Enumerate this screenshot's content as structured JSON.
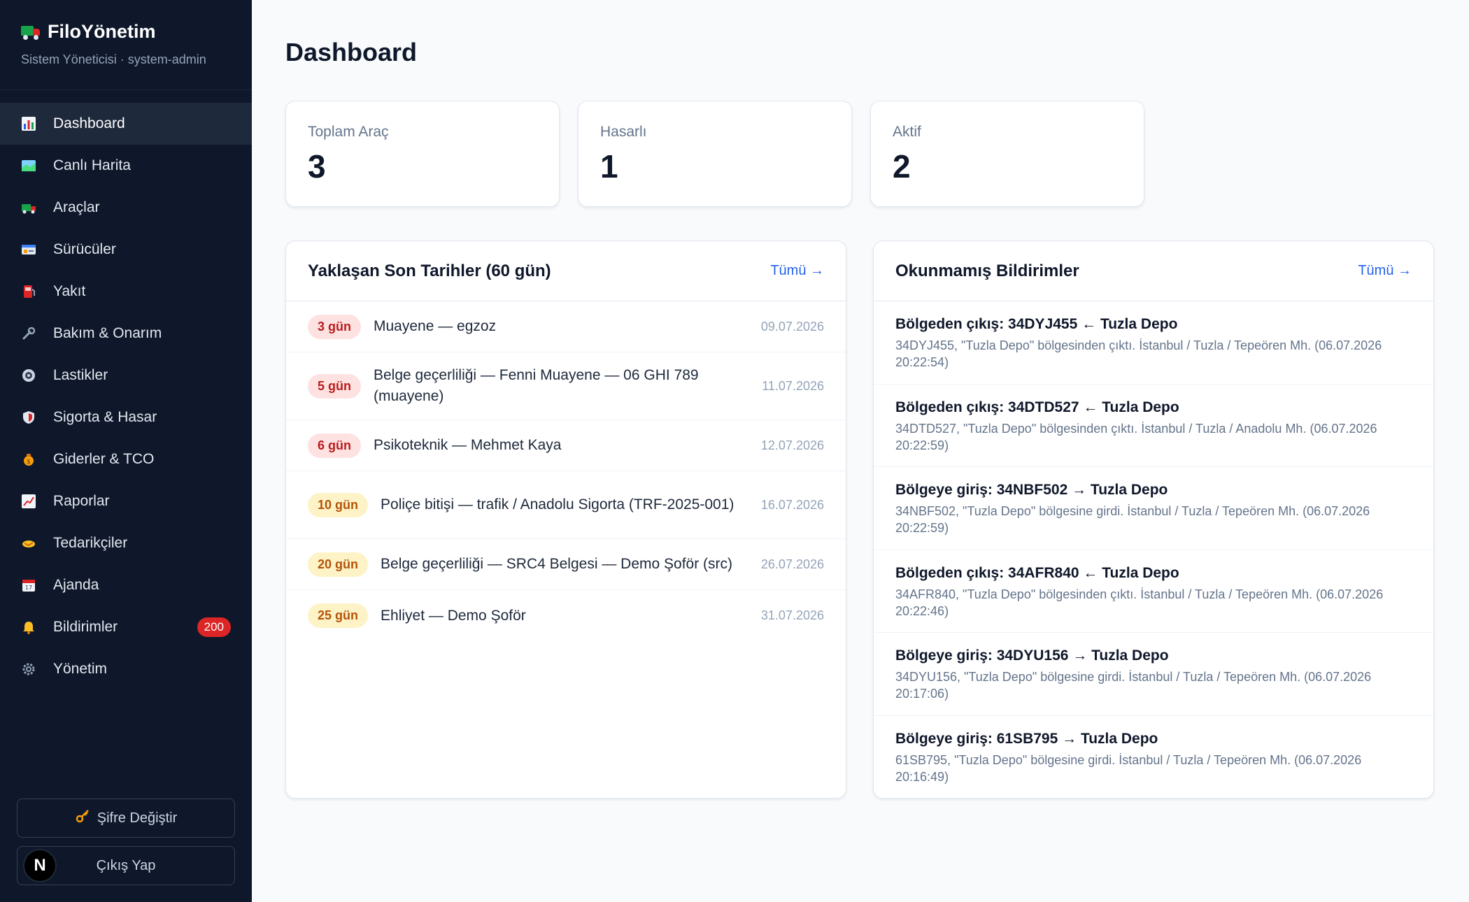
{
  "app": {
    "title": "FiloYönetim",
    "subtitle": "Sistem Yöneticisi · system-admin"
  },
  "sidebar": {
    "items": [
      {
        "label": "Dashboard",
        "icon": "bar-chart-icon"
      },
      {
        "label": "Canlı Harita",
        "icon": "map-icon"
      },
      {
        "label": "Araçlar",
        "icon": "truck-icon"
      },
      {
        "label": "Sürücüler",
        "icon": "id-card-icon"
      },
      {
        "label": "Yakıt",
        "icon": "fuel-pump-icon"
      },
      {
        "label": "Bakım & Onarım",
        "icon": "wrench-icon"
      },
      {
        "label": "Lastikler",
        "icon": "tire-icon"
      },
      {
        "label": "Sigorta & Hasar",
        "icon": "shield-icon"
      },
      {
        "label": "Giderler & TCO",
        "icon": "money-bag-icon"
      },
      {
        "label": "Raporlar",
        "icon": "line-chart-icon"
      },
      {
        "label": "Tedarikçiler",
        "icon": "handshake-icon"
      },
      {
        "label": "Ajanda",
        "icon": "calendar-icon"
      },
      {
        "label": "Bildirimler",
        "icon": "bell-icon",
        "badge": "200"
      },
      {
        "label": "Yönetim",
        "icon": "gear-icon"
      }
    ],
    "change_password": "Şifre Değiştir",
    "logout": "Çıkış Yap",
    "avatar_letter": "N"
  },
  "main": {
    "title": "Dashboard",
    "stats": [
      {
        "label": "Toplam Araç",
        "value": "3"
      },
      {
        "label": "Hasarlı",
        "value": "1"
      },
      {
        "label": "Aktif",
        "value": "2"
      }
    ],
    "deadlines": {
      "title": "Yaklaşan Son Tarihler (60 gün)",
      "link": "Tümü →",
      "rows": [
        {
          "days": "3 gün",
          "text": "Muayene — egzoz",
          "date": "09.07.2026",
          "level": "red"
        },
        {
          "days": "5 gün",
          "text": "Belge geçerliliği — Fenni Muayene — 06 GHI 789 (muayene)",
          "date": "11.07.2026",
          "level": "red"
        },
        {
          "days": "6 gün",
          "text": "Psikoteknik — Mehmet Kaya",
          "date": "12.07.2026",
          "level": "red"
        },
        {
          "days": "10 gün",
          "text": "Poliçe bitişi — trafik / Anadolu Sigorta (TRF-2025-001)",
          "date": "16.07.2026",
          "level": "amber"
        },
        {
          "days": "20 gün",
          "text": "Belge geçerliliği — SRC4 Belgesi — Demo Şoför (src)",
          "date": "26.07.2026",
          "level": "amber"
        },
        {
          "days": "25 gün",
          "text": "Ehliyet — Demo Şoför",
          "date": "31.07.2026",
          "level": "amber"
        }
      ]
    },
    "notifications": {
      "title": "Okunmamış Bildirimler",
      "link": "Tümü →",
      "rows": [
        {
          "title": "Bölgeden çıkış: 34DYJ455 ← Tuzla Depo",
          "body": "34DYJ455, \"Tuzla Depo\" bölgesinden çıktı. İstanbul / Tuzla / Tepeören Mh. (06.07.2026 20:22:54)"
        },
        {
          "title": "Bölgeden çıkış: 34DTD527 ← Tuzla Depo",
          "body": "34DTD527, \"Tuzla Depo\" bölgesinden çıktı. İstanbul / Tuzla / Anadolu Mh. (06.07.2026 20:22:59)"
        },
        {
          "title": "Bölgeye giriş: 34NBF502 → Tuzla Depo",
          "body": "34NBF502, \"Tuzla Depo\" bölgesine girdi. İstanbul / Tuzla / Tepeören Mh. (06.07.2026 20:22:59)"
        },
        {
          "title": "Bölgeden çıkış: 34AFR840 ← Tuzla Depo",
          "body": "34AFR840, \"Tuzla Depo\" bölgesinden çıktı. İstanbul / Tuzla / Tepeören Mh. (06.07.2026 20:22:46)"
        },
        {
          "title": "Bölgeye giriş: 34DYU156 → Tuzla Depo",
          "body": "34DYU156, \"Tuzla Depo\" bölgesine girdi. İstanbul / Tuzla / Tepeören Mh. (06.07.2026 20:17:06)"
        },
        {
          "title": "Bölgeye giriş: 61SB795 → Tuzla Depo",
          "body": "61SB795, \"Tuzla Depo\" bölgesine girdi. İstanbul / Tuzla / Tepeören Mh. (06.07.2026 20:16:49)"
        }
      ]
    }
  }
}
